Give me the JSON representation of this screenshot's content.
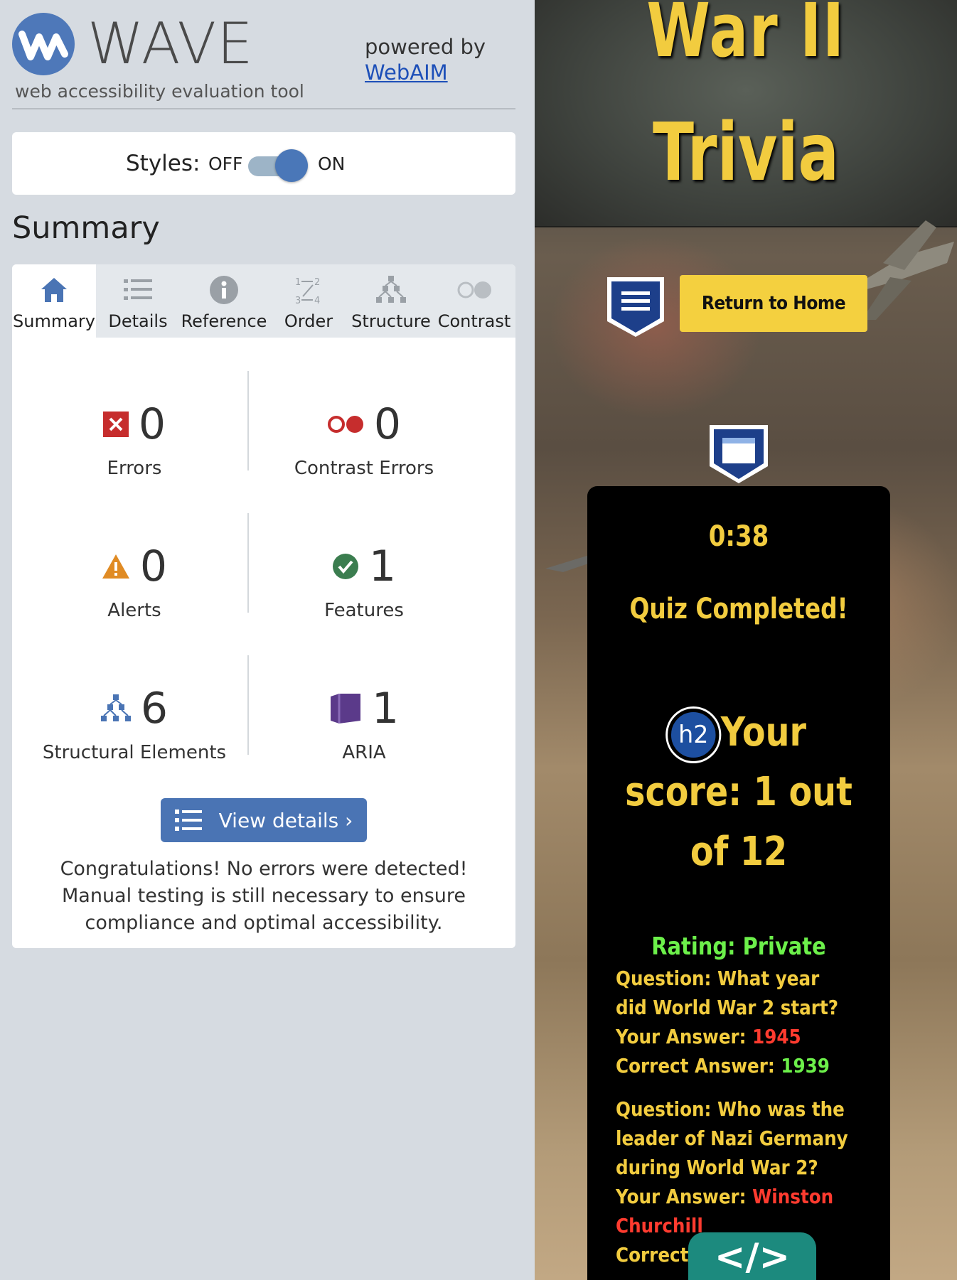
{
  "wave": {
    "logo_word": "WAVE",
    "tagline": "web accessibility evaluation tool",
    "powered_by": "powered by",
    "webaim_link": "WebAIM",
    "styles": {
      "label": "Styles:",
      "off": "OFF",
      "on": "ON",
      "state": "on"
    },
    "summary_heading": "Summary",
    "tabs": [
      {
        "label": "Summary",
        "icon": "home-icon",
        "active": true
      },
      {
        "label": "Details",
        "icon": "list-icon"
      },
      {
        "label": "Reference",
        "icon": "info-icon"
      },
      {
        "label": "Order",
        "icon": "order-icon"
      },
      {
        "label": "Structure",
        "icon": "structure-icon"
      },
      {
        "label": "Contrast",
        "icon": "contrast-icon"
      }
    ],
    "stats": {
      "errors": {
        "count": "0",
        "label": "Errors"
      },
      "contrast_errors": {
        "count": "0",
        "label": "Contrast Errors"
      },
      "alerts": {
        "count": "0",
        "label": "Alerts"
      },
      "features": {
        "count": "1",
        "label": "Features"
      },
      "structural": {
        "count": "6",
        "label": "Structural Elements"
      },
      "aria": {
        "count": "1",
        "label": "ARIA"
      }
    },
    "view_details": "View details ›",
    "congrats": "Congratulations! No errors were detected! Manual testing is still necessary to ensure compliance and optimal accessibility.",
    "colors": {
      "accent": "#4a74b4",
      "error": "#c0392b",
      "alert": "#e08b24",
      "feature": "#3b7d4f",
      "aria": "#5b3a8a"
    }
  },
  "page": {
    "title_line1": "War II",
    "title_line2": "Trivia",
    "return_home": "Return to Home",
    "timer": "0:38",
    "quiz_completed": "Quiz Completed!",
    "h2_badge": "h2",
    "score": "Your score: 1 out of 12",
    "rating": "Rating: Private",
    "qa": [
      {
        "q_label": "Question:",
        "question": "What year did World War 2 start?",
        "a_label": "Your Answer:",
        "answer": "1945",
        "c_label": "Correct Answer:",
        "correct": "1939"
      },
      {
        "q_label": "Question:",
        "question": "Who was the leader of Nazi Germany during World War 2?",
        "a_label": "Your Answer:",
        "answer": "Winston Churchill",
        "c_label": "Correct",
        "correct": ""
      }
    ],
    "code_badge": "</>",
    "colors": {
      "yellow": "#f2cc3f",
      "green": "#6cf04a",
      "red": "#ff3b2f"
    }
  }
}
